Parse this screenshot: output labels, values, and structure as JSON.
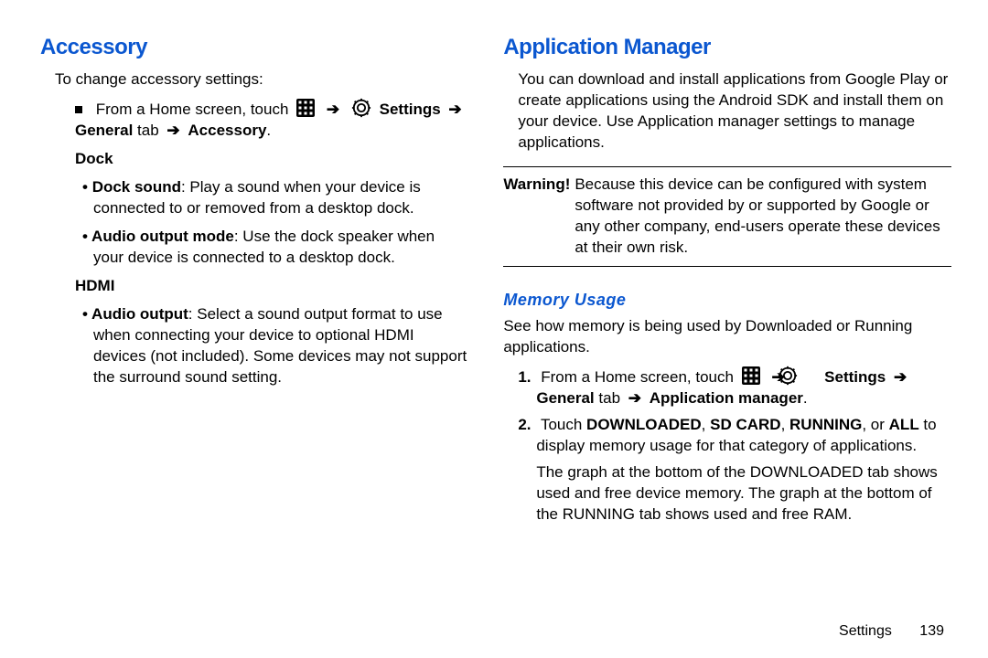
{
  "left": {
    "heading": "Accessory",
    "intro": "To change accessory settings:",
    "from_home": "From a Home screen, touch",
    "settings_label": "Settings",
    "general_tab": "General",
    "tab_word": "tab",
    "accessory_label": "Accessory",
    "dock_heading": "Dock",
    "dock_sound_label": "Dock sound",
    "dock_sound_text": ": Play a sound when your device is connected to or removed from a desktop dock.",
    "audio_output_mode_label": "Audio output mode",
    "audio_output_mode_text": ": Use the dock speaker when your device is connected to a desktop dock.",
    "hdmi_heading": "HDMI",
    "audio_output_label": "Audio output",
    "audio_output_text": ": Select a sound output format to use when connecting your device to optional HDMI devices (not included). Some devices may not support the surround sound setting."
  },
  "right": {
    "heading": "Application Manager",
    "intro": "You can download and install applications from Google Play or create applications using the Android SDK and install them on your device. Use Application manager settings to manage applications.",
    "warning_label": "Warning!",
    "warning_text": "Because this device can be configured with system software not provided by or supported by Google or any other company, end-users operate these devices at their own risk.",
    "memory_heading": "Memory Usage",
    "memory_intro": "See how memory is being used by Downloaded or Running applications.",
    "step1_pre": "From a Home screen, touch",
    "settings_label": "Settings",
    "general_tab": "General",
    "tab_word": "tab",
    "appmgr_label": "Application manager",
    "step2_pre": "Touch ",
    "downloaded": "DOWNLOADED",
    "sdcard": "SD CARD",
    "running": "RUNNING",
    "all": "ALL",
    "step2_post": " to display memory usage for that category of applications.",
    "step_extra": "The graph at the bottom of the DOWNLOADED tab shows used and free device memory. The graph at the bottom of the RUNNING tab shows used and free RAM."
  },
  "footer": {
    "section": "Settings",
    "page": "139"
  }
}
